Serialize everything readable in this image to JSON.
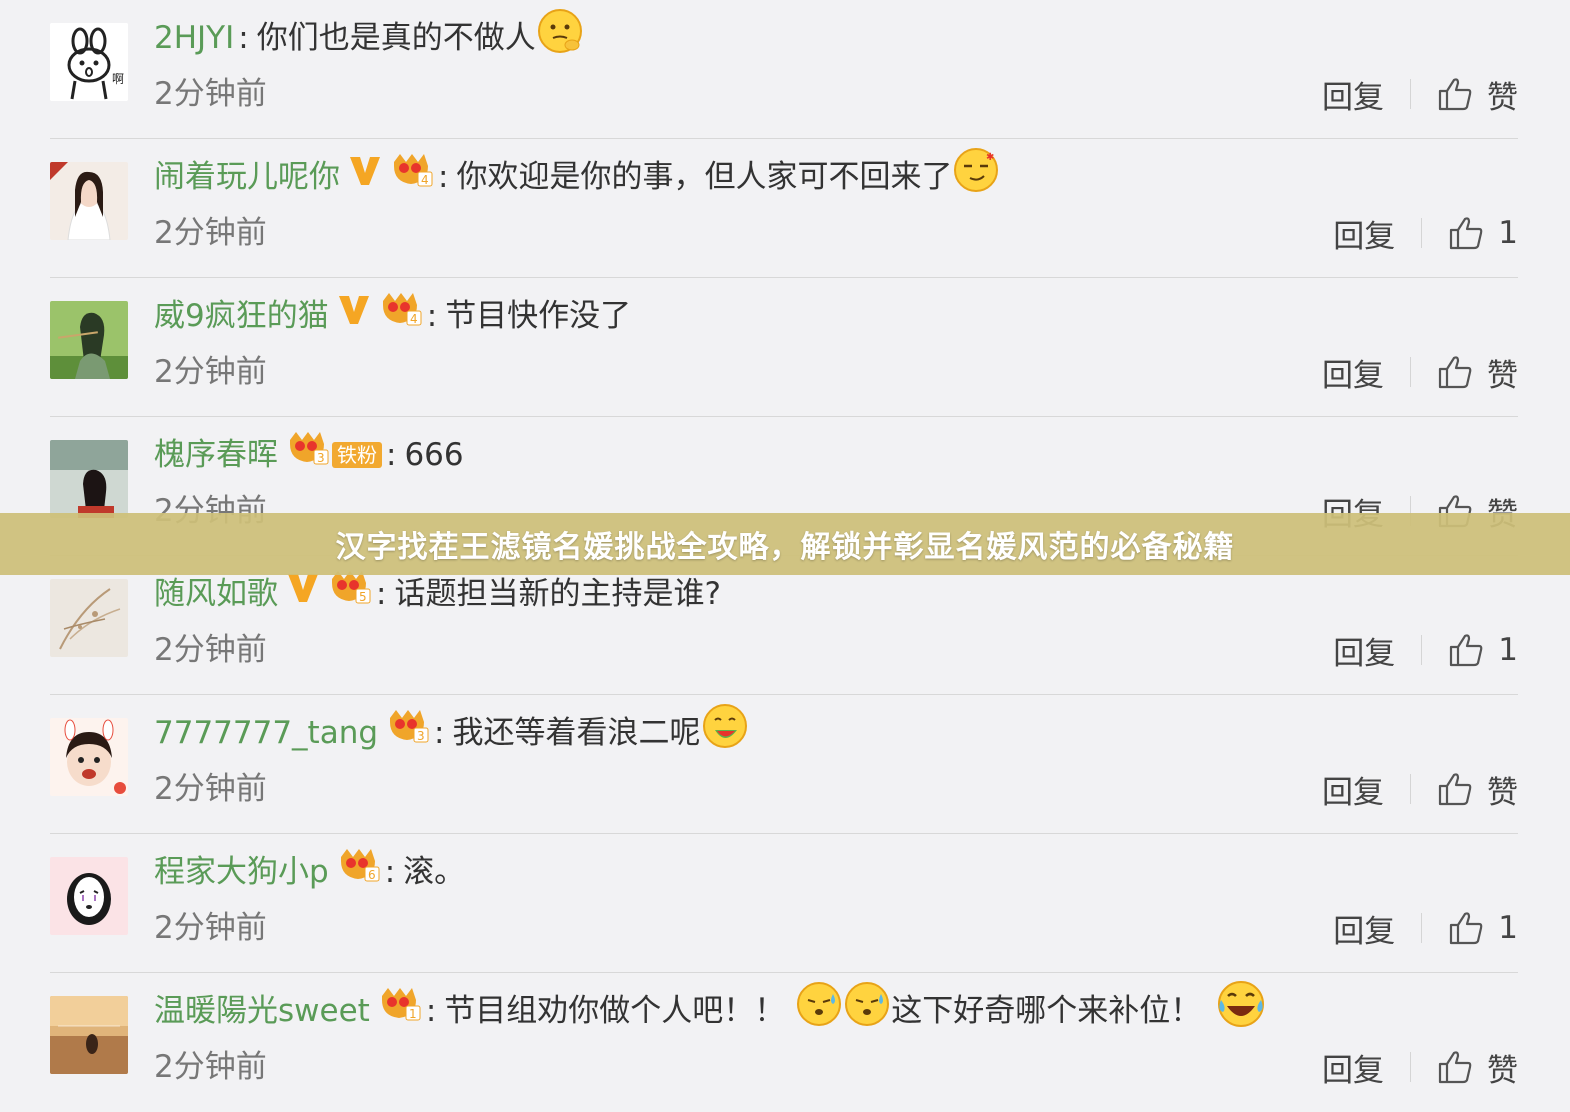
{
  "comments": [
    {
      "username": "2HJYI",
      "verified": false,
      "level": "",
      "fan": "",
      "text": "你们也是真的不做人",
      "emoji_after": [
        "thinking-emoji"
      ],
      "time": "2分钟前",
      "reply": "回复",
      "like": "赞"
    },
    {
      "username": "闹着玩儿呢你",
      "verified": true,
      "level": "4",
      "fan": "",
      "text": "你欢迎是你的事，但人家可不回来了",
      "emoji_after": [
        "smirk-emoji"
      ],
      "time": "2分钟前",
      "reply": "回复",
      "like": "1"
    },
    {
      "username": "威9疯狂的猫",
      "verified": true,
      "level": "4",
      "fan": "",
      "text": "节目快作没了",
      "emoji_after": [],
      "time": "2分钟前",
      "reply": "回复",
      "like": "赞"
    },
    {
      "username": "槐序春晖",
      "verified": false,
      "level": "3",
      "fan": "铁粉",
      "text": "666",
      "emoji_after": [],
      "time": "2分钟前",
      "reply": "回复",
      "like": "赞"
    },
    {
      "username": "随风如歌",
      "verified": true,
      "level": "5",
      "fan": "",
      "text": "话题担当新的主持是谁?",
      "emoji_after": [],
      "time": "2分钟前",
      "reply": "回复",
      "like": "1"
    },
    {
      "username": "7777777_tang",
      "verified": false,
      "level": "3",
      "fan": "",
      "text": "我还等着看浪二呢",
      "emoji_after": [
        "eating-melon-emoji"
      ],
      "time": "2分钟前",
      "reply": "回复",
      "like": "赞"
    },
    {
      "username": "程家大狗小p",
      "verified": false,
      "level": "6",
      "fan": "",
      "text": "滚。",
      "emoji_after": [],
      "time": "2分钟前",
      "reply": "回复",
      "like": "1"
    },
    {
      "username": "温暖陽光sweet",
      "verified": false,
      "level": "1",
      "fan": "",
      "text": "节目组劝你做个人吧！！",
      "text2": "这下好奇哪个来补位！",
      "emoji_mid": [
        "sweat-emoji",
        "sweat-emoji"
      ],
      "emoji_after": [
        "laugh-cry-emoji"
      ],
      "time": "2分钟前",
      "reply": "回复",
      "like": "赞"
    }
  ],
  "banner": {
    "text": "汉字找茬王滤镜名媛挑战全攻略，解锁并彰显名媛风范的必备秘籍"
  },
  "colors": {
    "username": "#5a9b57",
    "verified": "#f5a623",
    "banner": "#cdc078"
  }
}
